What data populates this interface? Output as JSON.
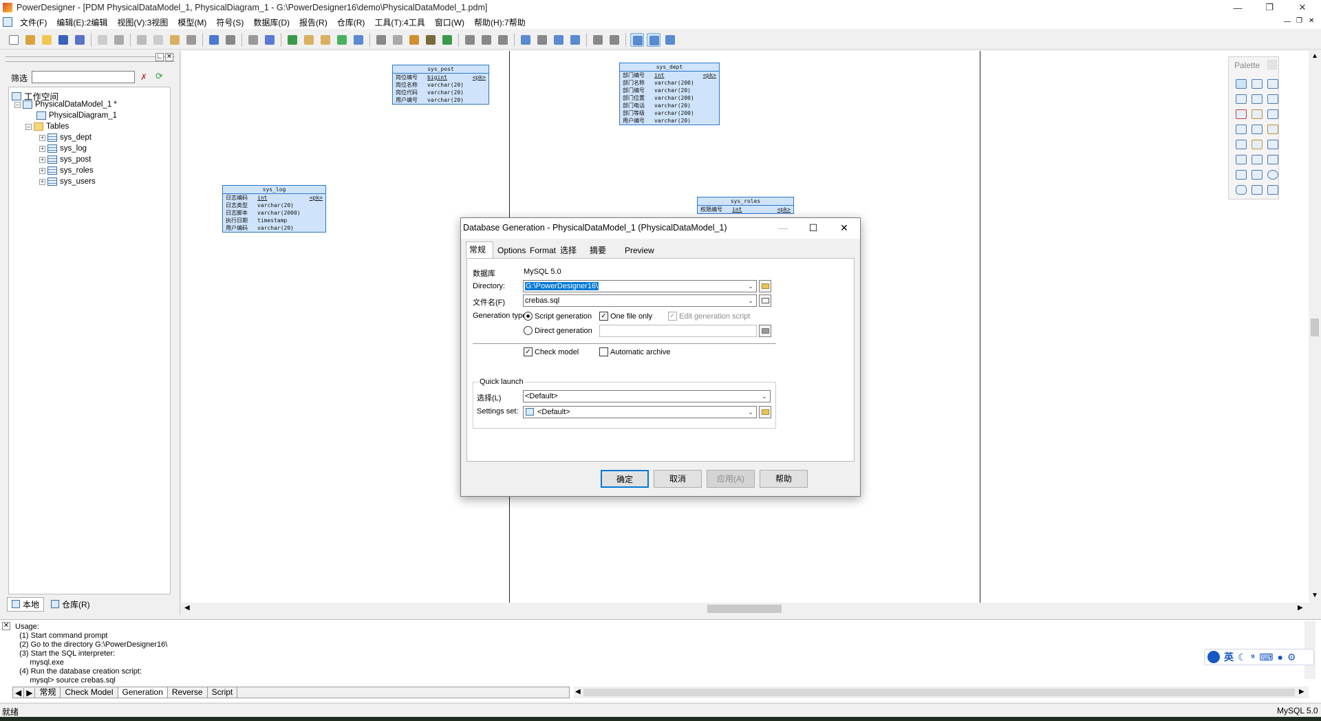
{
  "window": {
    "title": "PowerDesigner - [PDM PhysicalDataModel_1, PhysicalDiagram_1 - G:\\PowerDesigner16\\demo\\PhysicalDataModel_1.pdm]"
  },
  "menu": [
    "文件(F)",
    "编辑(E):2编辑",
    "视图(V):3视图",
    "模型(M)",
    "符号(S)",
    "数据库(D)",
    "报告(R)",
    "仓库(R)",
    "工具(T):4工具",
    "窗口(W)",
    "帮助(H):7帮助"
  ],
  "browser": {
    "filter_label": "筛选",
    "filter_value": "",
    "tree": {
      "workspace": "工作空间",
      "model": "PhysicalDataModel_1 *",
      "diagram": "PhysicalDiagram_1",
      "tables_folder": "Tables",
      "tables": [
        "sys_dept",
        "sys_log",
        "sys_post",
        "sys_roles",
        "sys_users"
      ]
    },
    "tabs": [
      "本地",
      "仓库(R)"
    ]
  },
  "diagram": {
    "tables": {
      "sys_post": {
        "name": "sys_post",
        "rows": [
          {
            "col": "岗位编号",
            "type": "bigint",
            "key": "<pk>"
          },
          {
            "col": "岗位名称",
            "type": "varchar(20)",
            "key": ""
          },
          {
            "col": "岗位代码",
            "type": "varchar(20)",
            "key": ""
          },
          {
            "col": "用户编号",
            "type": "varchar(20)",
            "key": ""
          }
        ]
      },
      "sys_dept": {
        "name": "sys_dept",
        "rows": [
          {
            "col": "部门编号",
            "type": "int",
            "key": "<pk>"
          },
          {
            "col": "部门名称",
            "type": "varchar(200)",
            "key": ""
          },
          {
            "col": "部门编号",
            "type": "varchar(20)",
            "key": ""
          },
          {
            "col": "部门位置",
            "type": "varchar(200)",
            "key": ""
          },
          {
            "col": "部门电话",
            "type": "varchar(20)",
            "key": ""
          },
          {
            "col": "部门等级",
            "type": "varchar(200)",
            "key": ""
          },
          {
            "col": "用户编号",
            "type": "varchar(20)",
            "key": ""
          }
        ]
      },
      "sys_log": {
        "name": "sys_log",
        "rows": [
          {
            "col": "日志编码",
            "type": "int",
            "key": "<pk>"
          },
          {
            "col": "日志类型",
            "type": "varchar(20)",
            "key": ""
          },
          {
            "col": "日志脚本",
            "type": "varchar(2000)",
            "key": ""
          },
          {
            "col": "执行日期",
            "type": "timestamp",
            "key": ""
          },
          {
            "col": "用户编码",
            "type": "varchar(20)",
            "key": ""
          }
        ]
      },
      "sys_roles": {
        "name": "sys_roles",
        "rows": [
          {
            "col": "权限编号",
            "type": "int",
            "key": "<pk>"
          }
        ]
      }
    }
  },
  "palette": {
    "title": "Palette"
  },
  "dialog": {
    "title": "Database Generation - PhysicalDataModel_1 (PhysicalDataModel_1)",
    "tabs": [
      "常规",
      "Options",
      "Format",
      "选择",
      "摘要",
      "Preview"
    ],
    "database_label": "数据库",
    "database_value": "MySQL 5.0",
    "directory_label": "Directory:",
    "directory_value": "G:\\PowerDesigner16\\",
    "filename_label": "文件名(F)",
    "filename_value": "crebas.sql",
    "gentype_label": "Generation type:",
    "script_gen": "Script generation",
    "direct_gen": "Direct generation",
    "one_file": "One file only",
    "edit_script": "Edit generation script",
    "check_model": "Check model",
    "auto_archive": "Automatic archive",
    "quick_launch": "Quick launch",
    "select_label": "选择(L)",
    "select_value": "<Default>",
    "settings_label": "Settings set:",
    "settings_value": "<Default>",
    "ok": "确定",
    "cancel": "取消",
    "apply": "应用(A)",
    "help": "帮助"
  },
  "output": {
    "text": "Usage:\n  (1) Start command prompt\n  (2) Go to the directory G:\\PowerDesigner16\\\n  (3) Start the SQL interpreter:\n       mysql.exe\n  (4) Run the database creation script:\n       mysql> source crebas.sql",
    "tabs": [
      "常规",
      "Check Model",
      "Generation",
      "Reverse",
      "Script"
    ]
  },
  "status": {
    "left": "就绪",
    "right": "MySQL 5.0"
  },
  "ime": {
    "lang": "英"
  }
}
